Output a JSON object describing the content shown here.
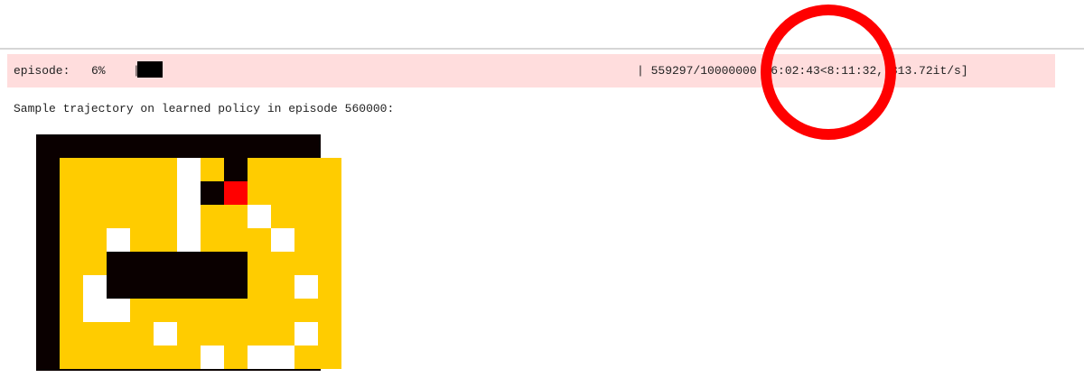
{
  "progress": {
    "label": "episode:",
    "percent_text": "6%",
    "separator_left": "|",
    "stats_text": "| 559297/10000000 [6:02:43<8:11:32, 313.72it/s]"
  },
  "output": {
    "sample_text": "Sample trajectory on learned policy in episode 560000:"
  },
  "grid": {
    "colors": {
      "wall": "#0a0000",
      "floor": "#ffcc00",
      "visited": "#ffffff",
      "agent": "#ff0000"
    },
    "rows": [
      "############",
      "#####V#A####",
      "#####V#AV###",
      "#####V######",
      "############",
      "############",
      "#V##########",
      "#V##########",
      "############",
      "############",
      "############"
    ]
  },
  "annotation": {
    "color": "#ff0000",
    "shape": "circle"
  }
}
